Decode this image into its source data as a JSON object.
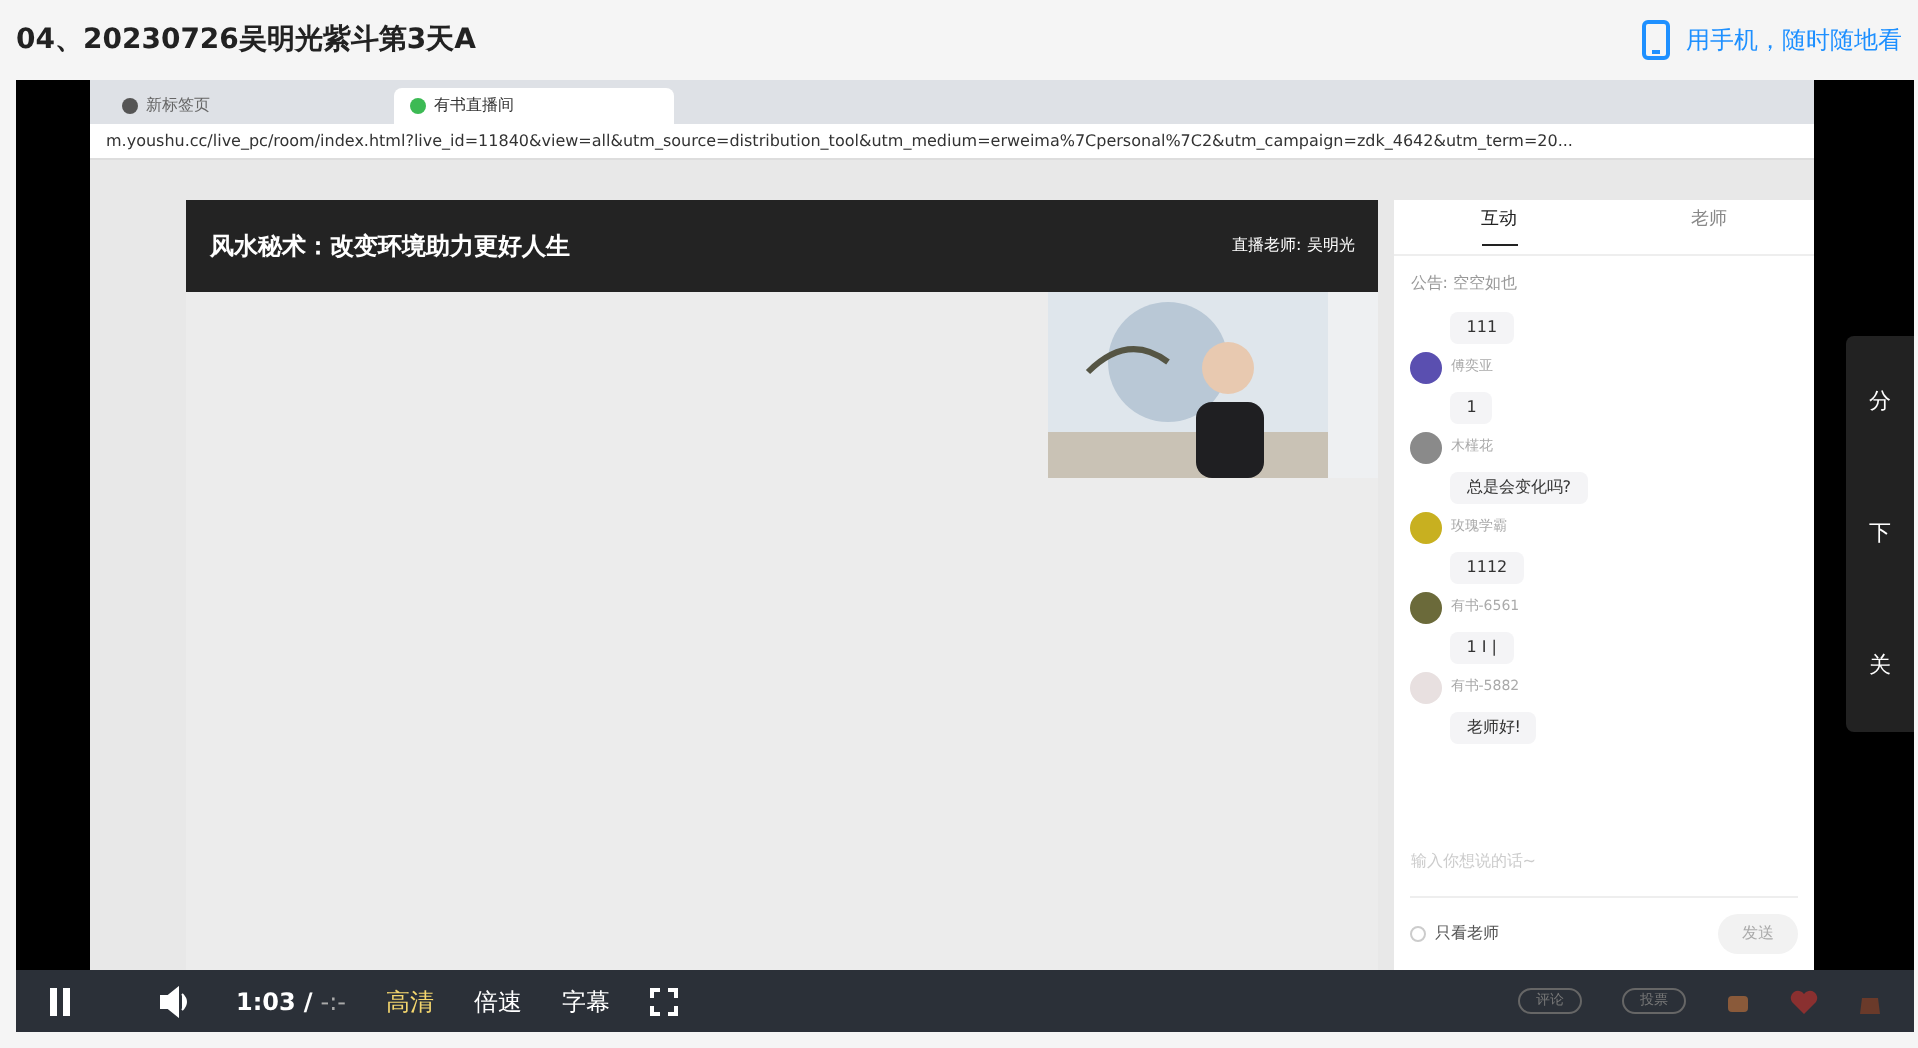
{
  "page": {
    "title": "04、20230726吴明光紫斗第3天A",
    "mobile_link": "用手机，随时随地看"
  },
  "browser": {
    "tabs": [
      {
        "label": "新标签页",
        "selected": false
      },
      {
        "label": "有书直播间",
        "selected": true
      }
    ],
    "url": "m.youshu.cc/live_pc/room/index.html?live_id=11840&view=all&utm_source=distribution_tool&utm_medium=erweima%7Cpersonal%7C2&utm_campaign=zdk_4642&utm_term=20..."
  },
  "live": {
    "title": "风水秘术：改变环境助力更好人生",
    "host": "直播老师: 吴明光"
  },
  "chat": {
    "tabs": [
      {
        "label": "互动",
        "selected": true
      },
      {
        "label": "老师",
        "selected": false
      }
    ],
    "notice": "公告: 空空如也",
    "messages": [
      {
        "text": "111"
      },
      {
        "user": "傅奕亚",
        "text": "1",
        "color": "#5a4fb0"
      },
      {
        "user": "木槿花",
        "text": "总是会变化吗?",
        "color": "#8a8a8a"
      },
      {
        "user": "玫瑰学霸",
        "text": "1112",
        "color": "#c8b020"
      },
      {
        "user": "有书-6561",
        "text": "1 I |",
        "color": "#6b6a3a"
      },
      {
        "user": "有书-5882",
        "text": "老师好!",
        "color": "#e8e0e0"
      }
    ],
    "placeholder": "输入你想说的话~",
    "teacher_only": {
      "label": "只看老师",
      "checked": false
    },
    "send": "发送"
  },
  "side_panel": [
    "分",
    "下",
    "关"
  ],
  "player": {
    "playing": true,
    "time": "1:03",
    "separator": "/",
    "duration": "-:-",
    "quality": "高清",
    "speed": "倍速",
    "subtitles": "字幕",
    "pills": [
      "评论",
      "投票"
    ]
  }
}
